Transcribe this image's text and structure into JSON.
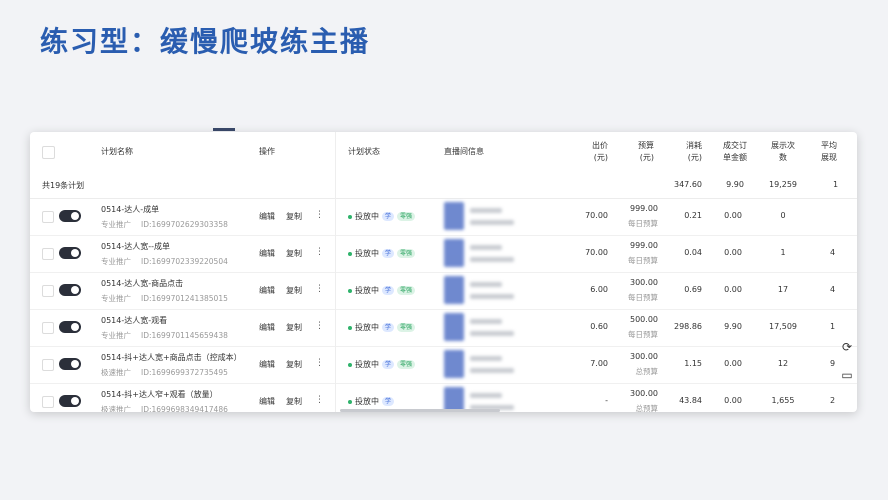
{
  "slide_title": "练习型：缓慢爬坡练主播",
  "header": {
    "name": "计划名称",
    "ops": "操作",
    "status": "计划状态",
    "live": "直播间信息",
    "bid": [
      "出价",
      "(元)"
    ],
    "budget": [
      "预算",
      "(元)"
    ],
    "cost": [
      "消耗",
      "(元)"
    ],
    "deal": [
      "成交订",
      "单金额"
    ],
    "show": [
      "展示次",
      "数"
    ],
    "avg": [
      "平均",
      "展现"
    ]
  },
  "summary": {
    "label": "共19条计划",
    "cost": "347.60",
    "deal": "9.90",
    "show": "19,259",
    "avg": "1"
  },
  "ops": {
    "edit": "编辑",
    "copy": "复制",
    "more": "⋮"
  },
  "rows": [
    {
      "name": "0514-达人-成单",
      "type": "专业推广",
      "id": "ID:1699702629303358",
      "status": "投放中",
      "badges": [
        "学",
        "零强"
      ],
      "bid": "70.00",
      "budget": "999.00",
      "budget_type": "每日预算",
      "cost": "0.21",
      "deal": "0.00",
      "show": "0",
      "avg": ""
    },
    {
      "name": "0514-达人宽--成单",
      "type": "专业推广",
      "id": "ID:1699702339220504",
      "status": "投放中",
      "badges": [
        "学",
        "零强"
      ],
      "bid": "70.00",
      "budget": "999.00",
      "budget_type": "每日预算",
      "cost": "0.04",
      "deal": "0.00",
      "show": "1",
      "avg": "4"
    },
    {
      "name": "0514-达人宽-商品点击",
      "type": "专业推广",
      "id": "ID:1699701241385015",
      "status": "投放中",
      "badges": [
        "学",
        "零强"
      ],
      "bid": "6.00",
      "budget": "300.00",
      "budget_type": "每日预算",
      "cost": "0.69",
      "deal": "0.00",
      "show": "17",
      "avg": "4"
    },
    {
      "name": "0514-达人宽-观看",
      "type": "专业推广",
      "id": "ID:1699701145659438",
      "status": "投放中",
      "badges": [
        "学",
        "零强"
      ],
      "bid": "0.60",
      "budget": "500.00",
      "budget_type": "每日预算",
      "cost": "298.86",
      "deal": "9.90",
      "show": "17,509",
      "avg": "1"
    },
    {
      "name": "0514-抖+达人宽+商品点击（控成本）",
      "type": "极速推广",
      "id": "ID:1699699372735495",
      "status": "投放中",
      "badges": [
        "学",
        "零强"
      ],
      "bid": "7.00",
      "budget": "300.00",
      "budget_type": "总预算",
      "cost": "1.15",
      "deal": "0.00",
      "show": "12",
      "avg": "9"
    },
    {
      "name": "0514-抖+达人窄+观看（放量）",
      "type": "极速推广",
      "id": "ID:1699698349417486",
      "status": "投放中",
      "badges": [
        "学"
      ],
      "bid": "-",
      "budget": "300.00",
      "budget_type": "总预算",
      "cost": "43.84",
      "deal": "0.00",
      "show": "1,655",
      "avg": "2"
    }
  ],
  "icons": {
    "refresh": "refresh-icon",
    "feedback": "message-icon"
  }
}
